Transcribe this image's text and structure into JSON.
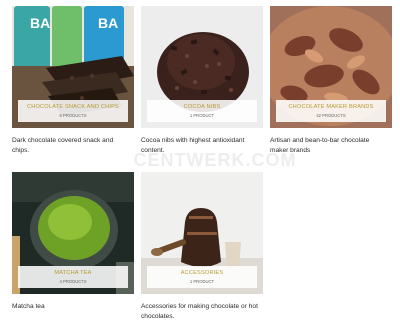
{
  "watermark": "CENTWERK.COM",
  "categories": [
    {
      "name": "CHOCOLATE SNACK AND CHIPS",
      "count": "6 PRODUCTS",
      "description": "Dark chocolate covered snack and chips.",
      "image": "chocolate-bars-photo"
    },
    {
      "name": "COCOA NIBS",
      "count": "1 PRODUCT",
      "description": "Cocoa nibs with highest antioxidant content.",
      "image": "cocoa-nibs-photo"
    },
    {
      "name": "CHOCOLATE MAKER BRANDS",
      "count": "42 PRODUCTS",
      "description": "Artisan and bean-to-bar chocolate maker brands",
      "image": "chocolate-shavings-photo"
    },
    {
      "name": "MATCHA TEA",
      "count": "4 PRODUCTS",
      "description": "Matcha tea",
      "image": "matcha-bowl-photo"
    },
    {
      "name": "ACCESSORIES",
      "count": "1 PRODUCT",
      "description": "Accessories for making chocolate or hot chocolates.",
      "image": "molinillo-accessories-photo"
    }
  ]
}
